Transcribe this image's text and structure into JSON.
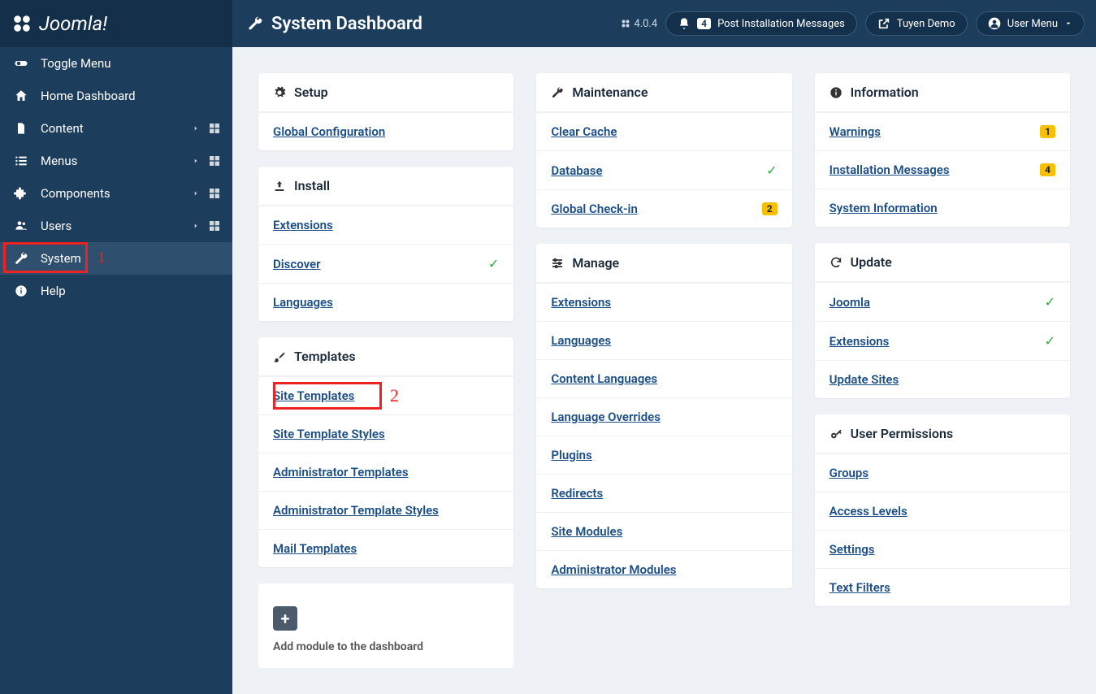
{
  "brand": "Joomla!",
  "header": {
    "page_title": "System Dashboard",
    "version": "4.0.4",
    "notif_count": "4",
    "post_install": "Post Installation Messages",
    "site_name": "Tuyen Demo",
    "user_menu": "User Menu"
  },
  "sidebar": {
    "toggle": "Toggle Menu",
    "home": "Home Dashboard",
    "content": "Content",
    "menus": "Menus",
    "components": "Components",
    "users": "Users",
    "system": "System",
    "help": "Help"
  },
  "annotations": {
    "one": "1",
    "two": "2"
  },
  "cards": {
    "setup": {
      "title": "Setup",
      "global_config": "Global Configuration"
    },
    "install": {
      "title": "Install",
      "extensions": "Extensions",
      "discover": "Discover",
      "languages": "Languages"
    },
    "templates": {
      "title": "Templates",
      "site_templates": "Site Templates",
      "site_template_styles": "Site Template Styles",
      "admin_templates": "Administrator Templates",
      "admin_template_styles": "Administrator Template Styles",
      "mail_templates": "Mail Templates"
    },
    "maintenance": {
      "title": "Maintenance",
      "clear_cache": "Clear Cache",
      "database": "Database",
      "global_checkin": "Global Check-in",
      "checkin_badge": "2"
    },
    "manage": {
      "title": "Manage",
      "extensions": "Extensions",
      "languages": "Languages",
      "content_languages": "Content Languages",
      "language_overrides": "Language Overrides",
      "plugins": "Plugins",
      "redirects": "Redirects",
      "site_modules": "Site Modules",
      "admin_modules": "Administrator Modules"
    },
    "information": {
      "title": "Information",
      "warnings": "Warnings",
      "warnings_badge": "1",
      "install_messages": "Installation Messages",
      "install_badge": "4",
      "system_info": "System Information"
    },
    "update": {
      "title": "Update",
      "joomla": "Joomla",
      "extensions": "Extensions",
      "update_sites": "Update Sites"
    },
    "permissions": {
      "title": "User Permissions",
      "groups": "Groups",
      "access_levels": "Access Levels",
      "settings": "Settings",
      "text_filters": "Text Filters"
    }
  },
  "add_module": "Add module to the dashboard"
}
